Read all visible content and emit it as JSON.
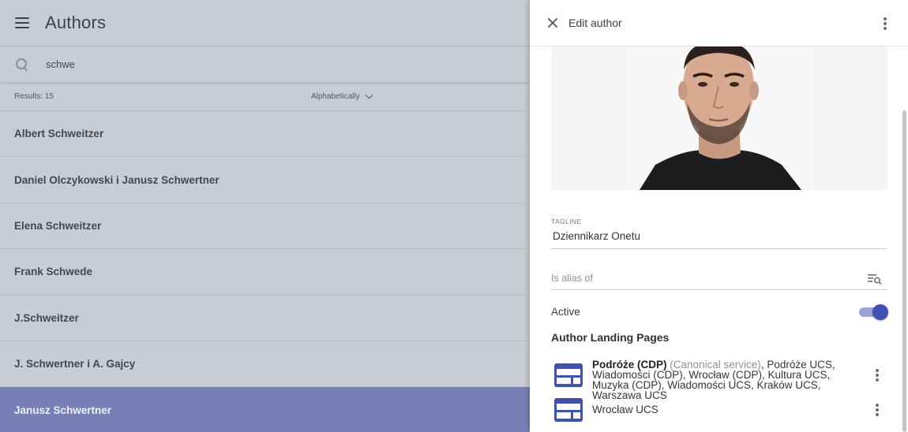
{
  "app": {
    "title": "Authors"
  },
  "search": {
    "value": "schwe"
  },
  "results": {
    "count_label": "Results: 15",
    "sort_label": "Alphabetically"
  },
  "authors": [
    {
      "name": "Albert Schweitzer"
    },
    {
      "name": "Daniel Olczykowski i Janusz Schwertner"
    },
    {
      "name": "Elena Schweitzer"
    },
    {
      "name": "Frank Schwede"
    },
    {
      "name": "J.Schweitzer"
    },
    {
      "name": "J. Schwertner i A. Gajcy"
    },
    {
      "name": "Janusz Schwertner",
      "selected": true
    }
  ],
  "drawer": {
    "title": "Edit author",
    "tagline_label": "TAGLINE",
    "tagline_value": "Dziennikarz Onetu",
    "alias_placeholder": "Is alias of",
    "active_label": "Active",
    "active": true,
    "landing_title": "Author Landing Pages",
    "landing_pages": [
      {
        "primary": "Podróże (CDP)",
        "qualifier": "(Canonical service)",
        "rest": ", Podróże UCS, Wiadomości (CDP), Wrocław (CDP), Kultura UCS, Muzyka (CDP), Wiadomości UCS, Kraków UCS, Warszawa UCS"
      },
      {
        "primary": "",
        "qualifier": "",
        "rest": "Wrocław UCS"
      }
    ]
  },
  "colors": {
    "accent": "#3f51b5",
    "selected_row": "#7780b6"
  }
}
